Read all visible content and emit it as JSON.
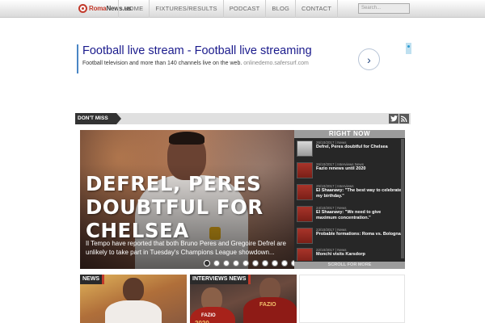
{
  "logo": {
    "text_a": "Roma",
    "text_b": "News.us"
  },
  "nav": {
    "items": [
      "HOME",
      "FIXTURES/RESULTS",
      "PODCAST",
      "BLOG",
      "CONTACT"
    ]
  },
  "search": {
    "placeholder": "Search..."
  },
  "ad": {
    "title": "Football live stream - Football live streaming",
    "description": "Football television and more than 140 channels live on the web.",
    "url": "onlinedemo.safersurf.com",
    "arrow": "›"
  },
  "dont_miss": {
    "label": "DON'T MISS"
  },
  "social": {
    "twitter_icon": "twitter-icon",
    "rss_icon": "rss-icon"
  },
  "featured": {
    "title": "DEFREL, PERES DOUBTFUL FOR CHELSEA",
    "excerpt": "Il Tempo have reported that both Bruno Peres and Gregoire Defrel are unlikely to take part in Tuesday's Champions League showdown...",
    "slide_count": 10,
    "active_slide": 1
  },
  "right_now": {
    "title": "RIGHT NOW",
    "items": [
      {
        "meta": "26/10/2017  |  News",
        "title": "Defrel, Peres doubtful for Chelsea"
      },
      {
        "meta": "26/10/2017  |  Interviews News",
        "title": "Fazio renews until 2020"
      },
      {
        "meta": "25/10/2017  |  Interviews",
        "title": "El Shaarawy: \"The best way to celebrate my birthday.\""
      },
      {
        "meta": "24/10/2017  |  News",
        "title": "El Shaarawy: \"We need to give maximum concentration.\""
      },
      {
        "meta": "23/10/2017  |  News",
        "title": "Probable formations: Roma vs. Bologna"
      },
      {
        "meta": "22/10/2017  |  News",
        "title": "Monchi visits Karsdorp"
      }
    ],
    "scroll_label": "SCROLL FOR MORE"
  },
  "cards": [
    {
      "label": "NEWS"
    },
    {
      "label": "INTERVIEWS NEWS",
      "shirt_text_1": "FAZIO",
      "shirt_text_2": "FAZIO",
      "shirt_year": "2020"
    }
  ]
}
